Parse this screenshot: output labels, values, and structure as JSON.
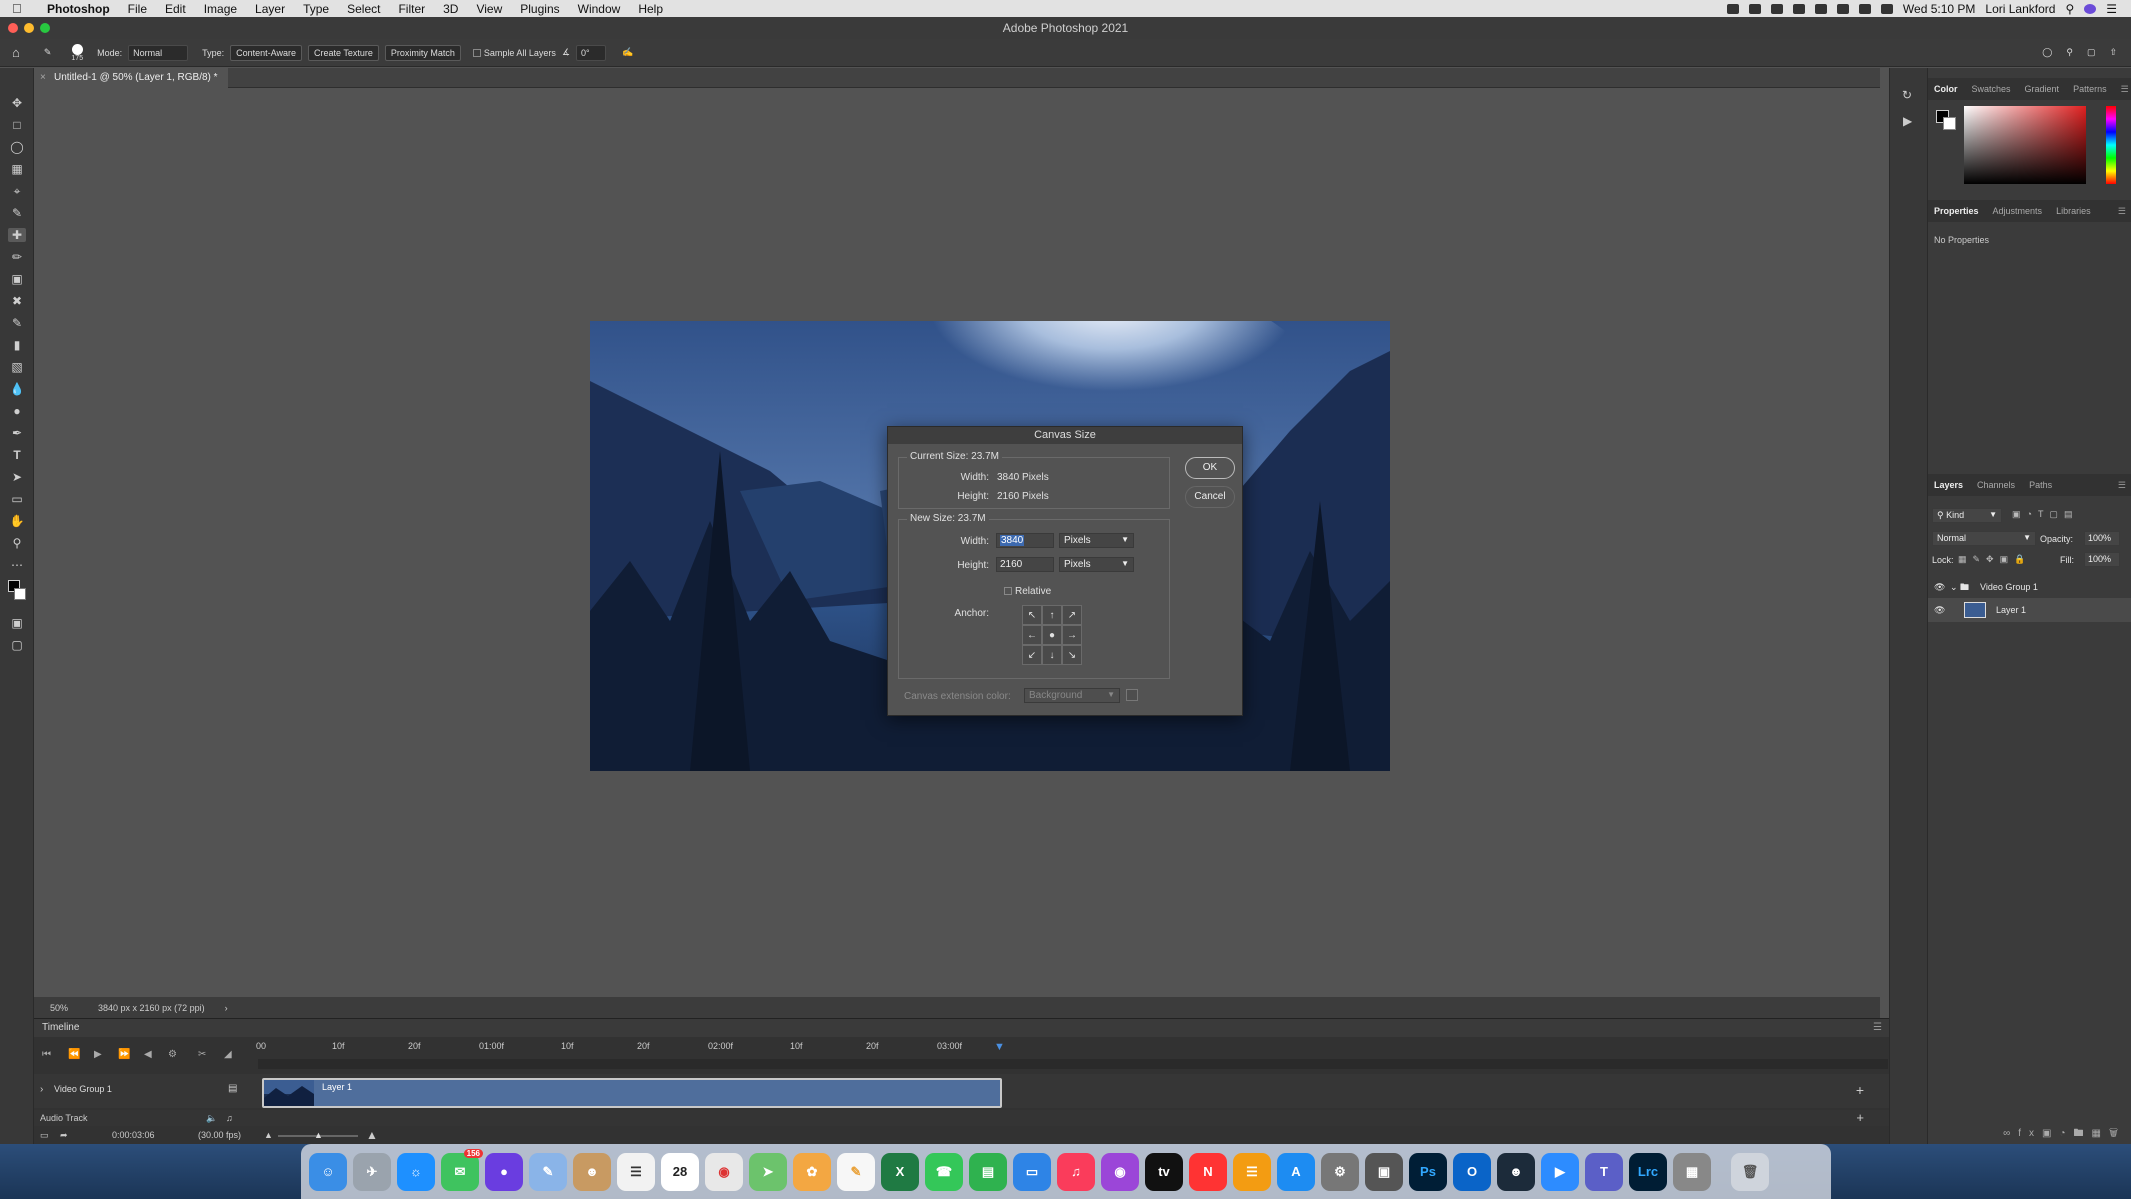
{
  "menubar": {
    "app": "Photoshop",
    "items": [
      "File",
      "Edit",
      "Image",
      "Layer",
      "Type",
      "Select",
      "Filter",
      "3D",
      "View",
      "Plugins",
      "Window",
      "Help"
    ],
    "clock": "Wed 5:10 PM",
    "user": "Lori Lankford"
  },
  "window": {
    "title": "Adobe Photoshop 2021"
  },
  "options": {
    "brush_size": "175",
    "mode_label": "Mode:",
    "mode_value": "Normal",
    "type_label": "Type:",
    "type_options": [
      "Content-Aware",
      "Create Texture",
      "Proximity Match"
    ],
    "sample_all": "Sample All Layers",
    "angle": "0°"
  },
  "document": {
    "tab": "Untitled-1 @ 50% (Layer 1, RGB/8) *"
  },
  "status": {
    "zoom": "50%",
    "info": "3840 px x 2160 px (72 ppi)"
  },
  "timeline": {
    "title": "Timeline",
    "ticks": [
      "00",
      "10f",
      "20f",
      "01:00f",
      "10f",
      "20f",
      "02:00f",
      "10f",
      "20f",
      "03:00f"
    ],
    "group": "Video Group 1",
    "clip": "Layer 1",
    "audio": "Audio Track",
    "timecode": "0:00:03:06",
    "fps": "(30.00 fps)"
  },
  "panels": {
    "color_tabs": [
      "Color",
      "Swatches",
      "Gradient",
      "Patterns"
    ],
    "prop_tabs": [
      "Properties",
      "Adjustments",
      "Libraries"
    ],
    "no_props": "No Properties",
    "layer_tabs": [
      "Layers",
      "Channels",
      "Paths"
    ],
    "kind": "Kind",
    "blend": "Normal",
    "opacity_label": "Opacity:",
    "opacity": "100%",
    "lock_label": "Lock:",
    "fill_label": "Fill:",
    "fill": "100%",
    "layers": [
      "Video Group 1",
      "Layer 1"
    ]
  },
  "dialog": {
    "title": "Canvas Size",
    "current_legend": "Current Size: 23.7M",
    "width_label": "Width:",
    "height_label": "Height:",
    "current_width": "3840 Pixels",
    "current_height": "2160 Pixels",
    "new_legend": "New Size: 23.7M",
    "new_width": "3840",
    "new_height": "2160",
    "unit": "Pixels",
    "relative": "Relative",
    "anchor_label": "Anchor:",
    "ext_label": "Canvas extension color:",
    "ext_value": "Background",
    "ok": "OK",
    "cancel": "Cancel"
  },
  "dock": {
    "badges": {
      "messages": "156",
      "calendar_day": "28"
    },
    "labels": [
      "Ps",
      "Lrc"
    ]
  },
  "colors": {
    "accent": "#3d6ab0",
    "clip": "#4f6e9c"
  }
}
